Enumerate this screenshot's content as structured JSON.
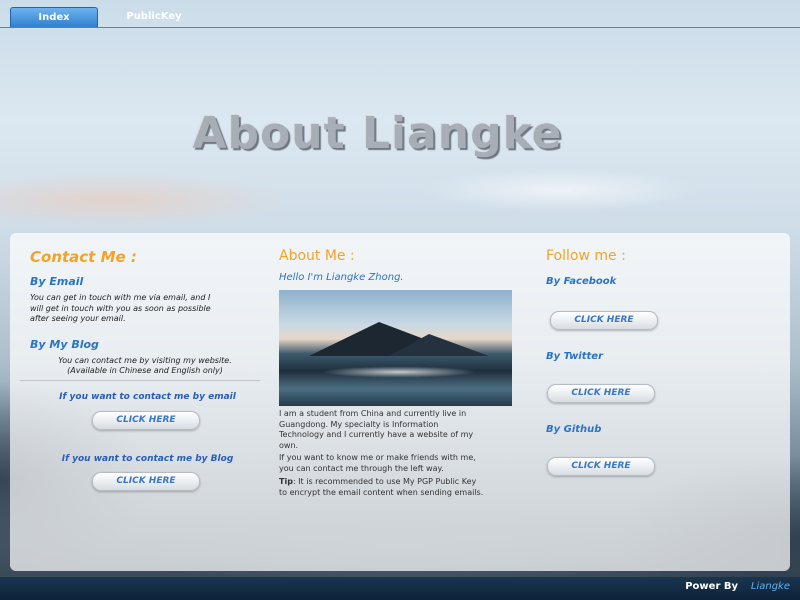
{
  "nav": {
    "tabs": [
      {
        "label": "Index",
        "active": true
      },
      {
        "label": "PublicKey",
        "active": false
      }
    ]
  },
  "page_title": "About Liangke",
  "contact": {
    "title": "Contact Me :",
    "email_heading": "By Email",
    "email_text_1": "You can get in touch with me via email, and I",
    "email_text_2": "will get in touch with you as soon as possible",
    "email_text_3": "after seeing your email.",
    "blog_heading": "By My Blog",
    "blog_text_1": "You can contact me by visiting my website.",
    "blog_text_2": "(Available in Chinese and English only)",
    "email_cta": "If you want to contact me by email",
    "email_button": "CLICK HERE",
    "blog_cta": "If you want to contact me by  Blog",
    "blog_button": "CLICK HERE"
  },
  "about": {
    "title": "About Me :",
    "greeting": "Hello I'm Liangke Zhong.",
    "para1_1": "I am a student from China and currently live in",
    "para1_2": "Guangdong. My specialty is Information",
    "para1_3": "Technology and I currently have a website of my",
    "para1_4": "own.",
    "para2_1": "If you want to know me or make friends with me,",
    "para2_2": "you can contact me through the left way.",
    "tip_label": "Tip",
    "tip_text_1": ": It is recommended to use My PGP Public Key",
    "tip_text_2": "to encrypt the email content when sending emails."
  },
  "follow": {
    "title": "Follow me :",
    "facebook_heading": "By Facebook",
    "facebook_button": "CLICK HERE",
    "twitter_heading": "By Twitter",
    "twitter_button": "CLICK HERE",
    "github_heading": "By Github",
    "github_button": "CLICK HERE"
  },
  "footer": {
    "label": "Power By",
    "link": "Liangke"
  },
  "colors": {
    "accent_orange": "#f1a428",
    "link_blue": "#2a74c4",
    "footer_bg": "#0d2238"
  }
}
